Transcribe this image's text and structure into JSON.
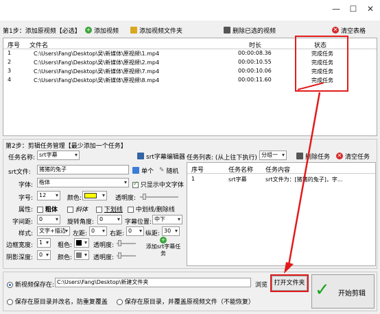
{
  "step1": {
    "label": "第1步：添加原视频【必选】",
    "add_video": "添加视频",
    "add_folder": "添加视频文件夹",
    "delete_selected": "删除已选的视频",
    "clear_table": "清空表格",
    "columns": [
      "序号",
      "文件名",
      "时长",
      "状态"
    ],
    "rows": [
      {
        "no": "1",
        "file": "C:\\Users\\Fang\\Desktop\\吴\\新媒体\\原视频\\1.mp4",
        "duration": "00:00:08.36",
        "status": "完成任务"
      },
      {
        "no": "2",
        "file": "C:\\Users\\Fang\\Desktop\\吴\\新媒体\\原视频\\2.mp4",
        "duration": "00:00:10.55",
        "status": "完成任务"
      },
      {
        "no": "3",
        "file": "C:\\Users\\Fang\\Desktop\\吴\\新媒体\\原视频\\7.mp4",
        "duration": "00:00:10.06",
        "status": "完成任务"
      },
      {
        "no": "4",
        "file": "C:\\Users\\Fang\\Desktop\\吴\\新媒体\\原视频\\8.mp4",
        "duration": "00:00:11.60",
        "status": "完成任务"
      }
    ]
  },
  "step2": {
    "label": "第2步：剪辑任务管理【最少添加一个任务】",
    "task_name_label": "任务名称:",
    "task_name_value": "srt字幕",
    "srt_editor": "srt字幕编辑器",
    "srt_file_label": "srt文件:",
    "srt_file_value": "猪猪的兔子",
    "single": "单个",
    "random": "随机",
    "font_label": "字体:",
    "font_value": "楷体",
    "only_chinese": "只显示中文字体",
    "size_label": "字号:",
    "size_value": "12",
    "color_label": "颜色:",
    "opacity_label": "透明度:",
    "attr_label": "属性:",
    "bold": "粗体",
    "italic": "斜体",
    "underline": "下划线",
    "strike": "中划线/删除线",
    "spacing_label": "字间距:",
    "spacing_value": "0",
    "rotate_label": "旋转角度:",
    "rotate_value": "0",
    "position_label": "字幕位置:",
    "position_value": "中下",
    "style_label": "样式:",
    "style_value": "文字+描边",
    "left_label": "左距:",
    "left_value": "0",
    "right_label": "右距:",
    "right_value": "0",
    "vert_label": "纵距:",
    "vert_value": "30",
    "border_label": "边框宽度:",
    "border_value": "1",
    "thick_color_label": "粗色:",
    "shadow_label": "阴影深度:",
    "shadow_value": "0",
    "add_task": "添加srt字幕任务",
    "task_list_label": "任务列表: (从上往下执行)",
    "group_value": "分组一",
    "delete_task": "删除任务",
    "clear_tasks": "清空任务",
    "task_columns": [
      "序号",
      "任务名称",
      "任务内容"
    ],
    "task_rows": [
      {
        "no": "1",
        "name": "srt字幕",
        "content": "srt文件为：[猪猪的兔子]，字..."
      }
    ]
  },
  "output": {
    "new_dir_label": "新视频保存在:",
    "path": "C:\\Users\\Fang\\Desktop\\新建文件夹",
    "browse": "浏览",
    "open_folder": "打开文件夹",
    "start": "开始剪辑",
    "opt_rename": "保存在原目录并改名，防重复覆盖",
    "opt_overwrite": "保存在原目录，并覆盖原视频文件（不能恢复）"
  },
  "colors": {
    "accent_red": "#e21a1a",
    "font_color": "#ffff00",
    "check_green": "#19a319"
  }
}
